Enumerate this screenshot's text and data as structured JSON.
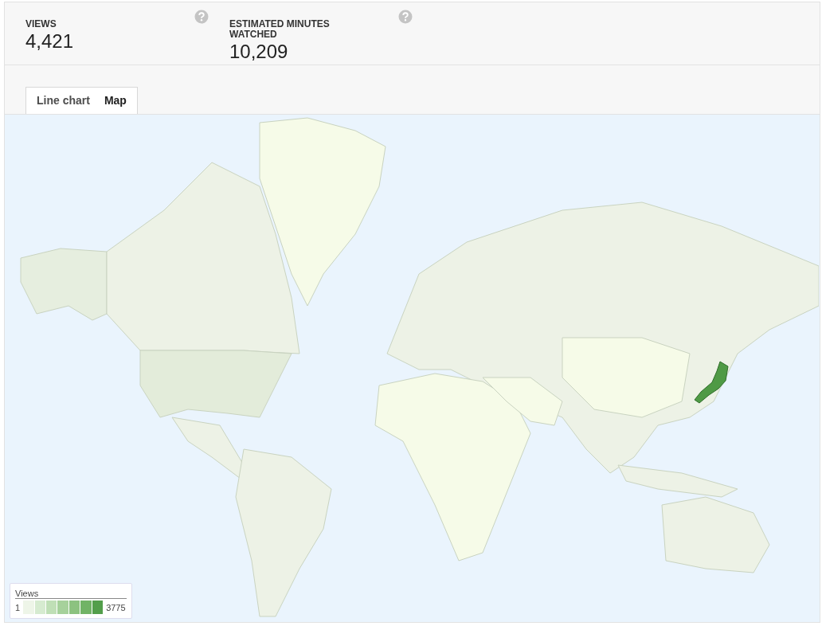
{
  "metrics": [
    {
      "label": "VIEWS",
      "value": "4,421"
    },
    {
      "label": "ESTIMATED MINUTES WATCHED",
      "value": "10,209"
    }
  ],
  "tabs": [
    {
      "label": "Line chart",
      "selected": false
    },
    {
      "label": "Map",
      "selected": true
    }
  ],
  "legend": {
    "title": "Views",
    "min": "1",
    "max": "3775"
  }
}
